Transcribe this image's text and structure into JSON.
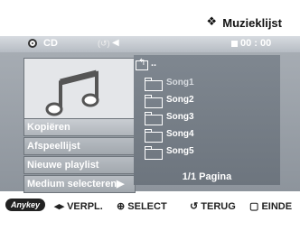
{
  "header": {
    "star": "❖",
    "title": "Muzieklijst"
  },
  "status": {
    "disc_label": "CD",
    "repeat_icon": "(↺)",
    "play_icon": "◀",
    "time": "00 : 00"
  },
  "menu": {
    "items": [
      {
        "label": "Kopiëren",
        "selected": true
      },
      {
        "label": "Afspeellijst",
        "selected": false
      },
      {
        "label": "Nieuwe playlist",
        "selected": false
      },
      {
        "label": "Medium selecteren▶",
        "selected": false
      }
    ]
  },
  "list": {
    "up_label": "..",
    "songs": [
      {
        "label": "Song1",
        "dim": true
      },
      {
        "label": "Song2",
        "dim": false
      },
      {
        "label": "Song3",
        "dim": false
      },
      {
        "label": "Song4",
        "dim": false
      },
      {
        "label": "Song5",
        "dim": false
      }
    ],
    "pagination": "1/1 Pagina"
  },
  "footer": {
    "anykey": "Anykey",
    "move": "◂▸ VERPL.",
    "select": "⊕ SELECT",
    "return": "↺ TERUG",
    "exit": "▢ EINDE"
  },
  "colors": {
    "panel": "#8d949c",
    "list": "#737b84",
    "accent": "#ffffff"
  }
}
